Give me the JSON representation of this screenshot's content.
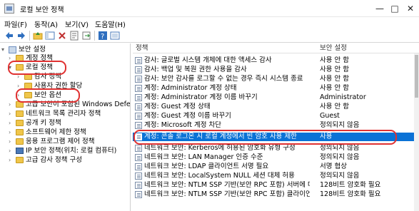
{
  "window": {
    "title": "로컬 보안 정책"
  },
  "menu": [
    "파일(F)",
    "동작(A)",
    "보기(V)",
    "도움말(H)"
  ],
  "toolbar_icons": [
    "back-icon",
    "forward-icon",
    "up-folder-icon",
    "show-tree-icon",
    "delete-icon",
    "properties-icon",
    "export-icon",
    "help-icon",
    "snapin-icon"
  ],
  "tree": [
    {
      "label": "보안 설정",
      "depth": 0,
      "expanded": true,
      "icon": "security-icon"
    },
    {
      "label": "계정 정책",
      "depth": 1,
      "expanded": false,
      "icon": "folder-icon"
    },
    {
      "label": "로컬 정책",
      "depth": 1,
      "expanded": true,
      "icon": "folder-open-icon"
    },
    {
      "label": "감사 정책",
      "depth": 2,
      "expanded": false,
      "icon": "folder-icon"
    },
    {
      "label": "사용자 권한 할당",
      "depth": 2,
      "expanded": false,
      "icon": "folder-icon"
    },
    {
      "label": "보안 옵션",
      "depth": 2,
      "expanded": false,
      "icon": "folder-icon",
      "selected": true
    },
    {
      "label": "고급 보안이 포함된 Windows Defender 방화벽",
      "depth": 1,
      "expanded": false,
      "icon": "folder-icon"
    },
    {
      "label": "네트워크 목록 관리자 정책",
      "depth": 1,
      "expanded": false,
      "icon": "folder-icon"
    },
    {
      "label": "공개 키 정책",
      "depth": 1,
      "expanded": false,
      "icon": "folder-icon"
    },
    {
      "label": "소프트웨어 제한 정책",
      "depth": 1,
      "expanded": false,
      "icon": "folder-icon"
    },
    {
      "label": "응용 프로그램 제어 정책",
      "depth": 1,
      "expanded": false,
      "icon": "folder-icon"
    },
    {
      "label": "IP 보안 정책(위치: 로컬 컴퓨터)",
      "depth": 1,
      "expanded": false,
      "icon": "monitor-icon"
    },
    {
      "label": "고급 감사 정책 구성",
      "depth": 1,
      "expanded": false,
      "icon": "folder-icon"
    }
  ],
  "columns": {
    "policy": "정책",
    "setting": "보안 설정"
  },
  "rows": [
    {
      "policy": "감사: 글로벌 시스템 개체에 대한 액세스 감사",
      "setting": "사용 안 함"
    },
    {
      "policy": "감사: 백업 및 복원 권한 사용을 감사",
      "setting": "사용 안 함"
    },
    {
      "policy": "감사: 보안 감사를 로그할 수 없는 경우 즉시 시스템 종료",
      "setting": "사용 안 함"
    },
    {
      "policy": "계정: Administrator 계정 상태",
      "setting": "사용 안 함"
    },
    {
      "policy": "계정: Administrator 계정 이름 바꾸기",
      "setting": "Administrator"
    },
    {
      "policy": "계정: Guest 계정 상태",
      "setting": "사용 안 함"
    },
    {
      "policy": "계정: Guest 계정 이름 바꾸기",
      "setting": "Guest"
    },
    {
      "policy": "계정: Microsoft 계정 차단",
      "setting": "정의되지 않음"
    },
    {
      "policy": "계정: 콘솔 로그온 시 로컬 계정에서 빈 암호 사용 제한",
      "setting": "사용",
      "selected": true
    },
    {
      "policy": "네트워크 보안: Kerberos에 허용된 암호화 유형 구성",
      "setting": "정의되지 않음"
    },
    {
      "policy": "네트워크 보안: LAN Manager 인증 수준",
      "setting": "정의되지 않음"
    },
    {
      "policy": "네트워크 보안: LDAP 클라이언트 서명 필요",
      "setting": "서명 협상"
    },
    {
      "policy": "네트워크 보안: LocalSystem NULL 세션 대체 허용",
      "setting": "정의되지 않음"
    },
    {
      "policy": "네트워크 보안: NTLM SSP 기반(보안 RPC 포함) 서버에 대…",
      "setting": "128비트 암호화 필요"
    },
    {
      "policy": "네트워크 보안: NTLM SSP 기반(보안 RPC 포함) 클라이언…",
      "setting": "128비트 암호화 필요"
    }
  ],
  "colors": {
    "selection": "#0a72d6",
    "highlight_ring": "#e03131",
    "folder": "#f0c64a"
  }
}
